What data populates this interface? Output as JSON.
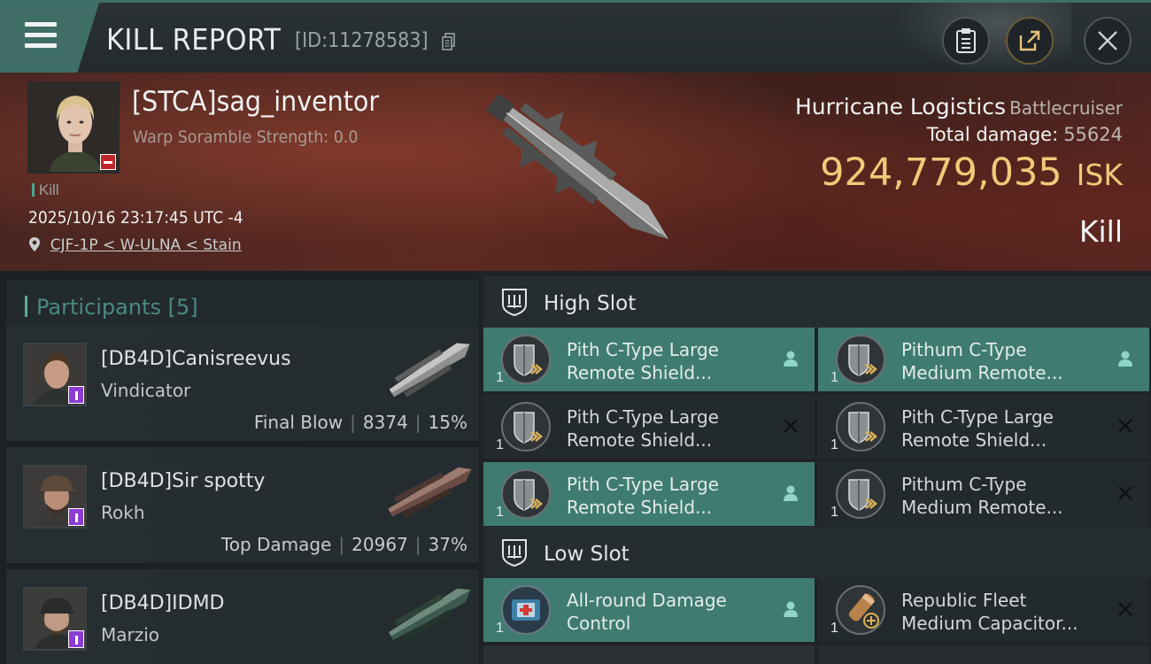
{
  "header": {
    "title": "KILL REPORT",
    "report_id": "[ID:11278583]"
  },
  "victim": {
    "name": "[STCA]sag_inventor",
    "warp_scramble": "Warp Soramble Strength: 0.0",
    "kill_tag": "Kill",
    "datetime": "2025/10/16 23:17:45 UTC -4",
    "location": "CJF-1P < W-ULNA < Stain",
    "ship_name": "Hurricane Logistics",
    "ship_class": "Battlecruiser",
    "total_damage_label": "Total damage:",
    "total_damage": "55624",
    "isk_value": "924,779,035",
    "isk_unit": "ISK",
    "result": "Kill"
  },
  "participants": {
    "label": "Participants",
    "count": "[5]",
    "rows": [
      {
        "name": "[DB4D]Canisreevus",
        "ship": "Vindicator",
        "tag": "Final Blow",
        "damage": "8374",
        "percent": "15%"
      },
      {
        "name": "[DB4D]Sir spotty",
        "ship": "Rokh",
        "tag": "Top Damage",
        "damage": "20967",
        "percent": "37%"
      },
      {
        "name": "[DB4D]IDMD",
        "ship": "Marzio",
        "tag": "",
        "damage": "",
        "percent": ""
      }
    ]
  },
  "slots": {
    "high_label": "High Slot",
    "low_label": "Low Slot",
    "high": [
      {
        "qty": "1",
        "name_line1": "Pith C-Type Large",
        "name_line2": "Remote Shield...",
        "active": true,
        "status": "person"
      },
      {
        "qty": "1",
        "name_line1": "Pithum C-Type",
        "name_line2": "Medium Remote...",
        "active": true,
        "status": "person"
      },
      {
        "qty": "1",
        "name_line1": "Pith C-Type Large",
        "name_line2": "Remote Shield...",
        "active": false,
        "status": "x"
      },
      {
        "qty": "1",
        "name_line1": "Pith C-Type Large",
        "name_line2": "Remote Shield...",
        "active": false,
        "status": "x"
      },
      {
        "qty": "1",
        "name_line1": "Pith C-Type Large",
        "name_line2": "Remote Shield...",
        "active": true,
        "status": "person"
      },
      {
        "qty": "1",
        "name_line1": "Pithum C-Type",
        "name_line2": "Medium Remote...",
        "active": false,
        "status": "x"
      }
    ],
    "low": [
      {
        "qty": "1",
        "name_line1": "All-round Damage",
        "name_line2": "Control",
        "active": true,
        "status": "person"
      },
      {
        "qty": "1",
        "name_line1": "Republic Fleet",
        "name_line2": "Medium Capacitor...",
        "active": false,
        "status": "x"
      }
    ]
  },
  "colors": {
    "accent_teal": "#3f7b71",
    "isk_gold": "#f3c879",
    "badge_purple": "#8b3dd3",
    "badge_red": "#c0262a"
  },
  "icons": [
    "menu-icon",
    "copy-icon",
    "clipboard-icon",
    "share-icon",
    "close-icon",
    "location-pin-icon",
    "slot-shield-icon",
    "person-icon",
    "x-icon"
  ]
}
